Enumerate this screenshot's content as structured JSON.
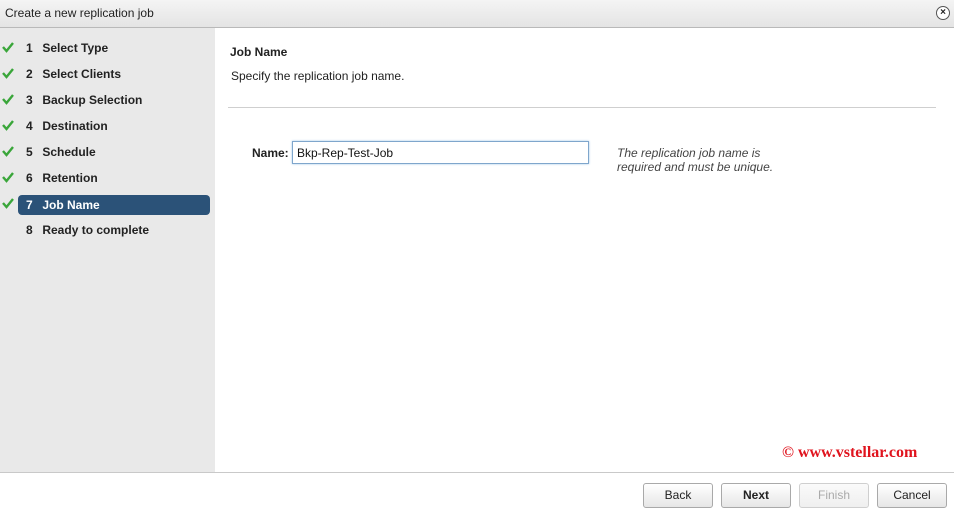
{
  "window": {
    "title": "Create a new replication job",
    "close_icon": "close-icon"
  },
  "steps": [
    {
      "number": "1",
      "label": "Select Type",
      "completed": true,
      "active": false
    },
    {
      "number": "2",
      "label": "Select Clients",
      "completed": true,
      "active": false
    },
    {
      "number": "3",
      "label": "Backup Selection",
      "completed": true,
      "active": false
    },
    {
      "number": "4",
      "label": "Destination",
      "completed": true,
      "active": false
    },
    {
      "number": "5",
      "label": "Schedule",
      "completed": true,
      "active": false
    },
    {
      "number": "6",
      "label": "Retention",
      "completed": true,
      "active": false
    },
    {
      "number": "7",
      "label": "Job Name",
      "completed": true,
      "active": true
    },
    {
      "number": "8",
      "label": "Ready to complete",
      "completed": false,
      "active": false
    }
  ],
  "main": {
    "heading": "Job Name",
    "subheading": "Specify the replication job name.",
    "name_label": "Name:",
    "name_value": "Bkp-Rep-Test-Job",
    "hint": "The replication job name is required and must be unique."
  },
  "watermark": "© www.vstellar.com",
  "footer": {
    "back": "Back",
    "next": "Next",
    "finish": "Finish",
    "cancel": "Cancel"
  },
  "colors": {
    "active_step": "#2b5278",
    "check": "#3aa63a",
    "watermark": "#e0141e"
  }
}
